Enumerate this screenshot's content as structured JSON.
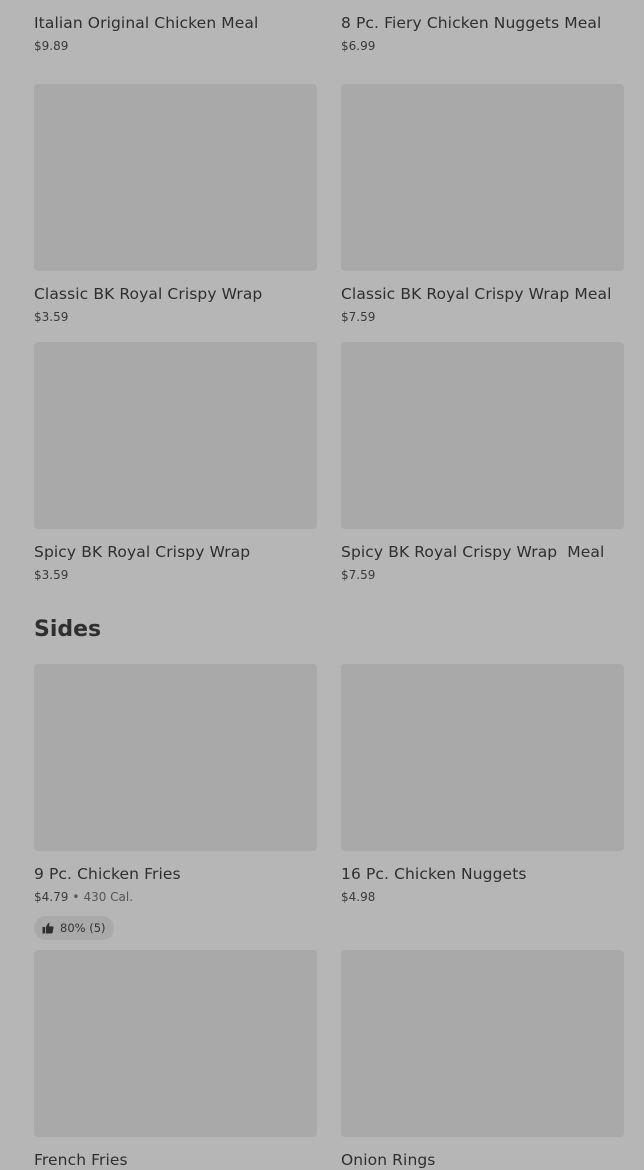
{
  "top_items": [
    {
      "name": "Italian Original Chicken Meal",
      "price": "$9.89"
    },
    {
      "name": "8 Pc. Fiery Chicken Nuggets Meal",
      "price": "$6.99"
    },
    {
      "name": "Classic BK Royal Crispy Wrap",
      "price": "$3.59"
    },
    {
      "name": "Classic BK Royal Crispy Wrap Meal",
      "price": "$7.59"
    },
    {
      "name": "Spicy BK Royal Crispy Wrap",
      "price": "$3.59"
    },
    {
      "name": "Spicy BK Royal Crispy Wrap  Meal",
      "price": "$7.59"
    }
  ],
  "sides": {
    "title": "Sides",
    "items": [
      {
        "name": "9 Pc. Chicken Fries",
        "price": "$4.79",
        "separator": "•",
        "calories": "430 Cal.",
        "rating": "80% (5)",
        "rating_icon": "thumbs-up-icon"
      },
      {
        "name": "16 Pc. Chicken Nuggets",
        "price": "$4.98"
      },
      {
        "name": "French Fries",
        "price": ""
      },
      {
        "name": "Onion Rings",
        "price": ""
      }
    ]
  },
  "colors": {
    "page_background": "#b6b6b6",
    "image_placeholder": "#a9a9a9",
    "text": "#2f2f2f"
  }
}
